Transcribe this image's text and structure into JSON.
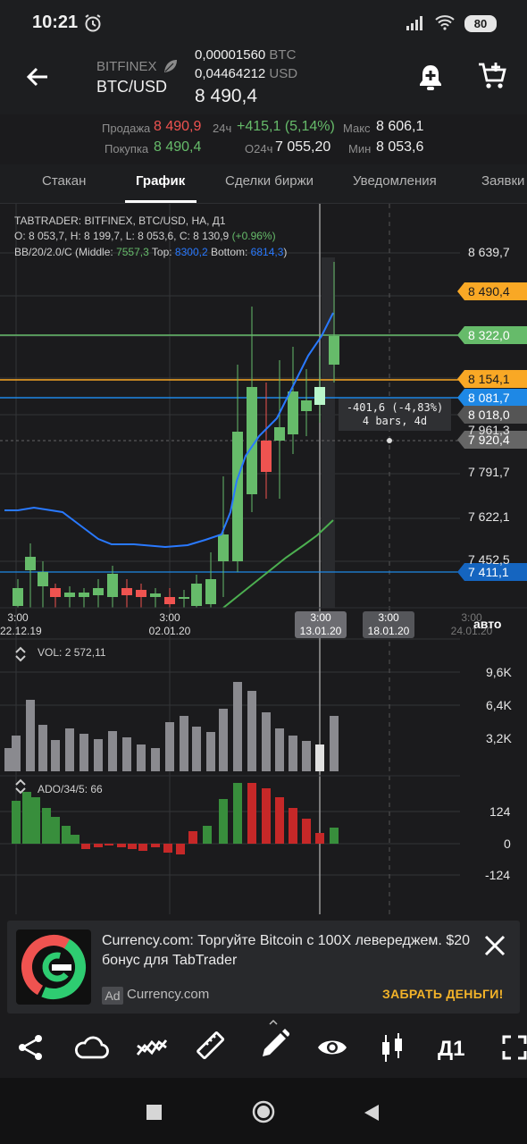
{
  "status_bar": {
    "time": "10:21",
    "battery": "80"
  },
  "header": {
    "exchange": "BITFINEX",
    "pair": "BTC/USD",
    "btc_value": "0,00001560",
    "btc_unit": "BTC",
    "usd_value": "0,04464212",
    "usd_unit": "USD",
    "price": "8 490,4"
  },
  "stats": {
    "sell_label": "Продажа",
    "sell_value": "8 490,9",
    "buy_label": "Покупка",
    "buy_value": "8 490,4",
    "change_label": "24ч",
    "change_value": "+415,1 (5,14%)",
    "volume_label": "О24ч",
    "volume_value": "7 055,20",
    "max_label": "Макс",
    "max_value": "8 606,1",
    "min_label": "Мин",
    "min_value": "8 053,6"
  },
  "tabs": [
    {
      "label": "Стакан"
    },
    {
      "label": "График"
    },
    {
      "label": "Сделки биржи"
    },
    {
      "label": "Уведомления"
    },
    {
      "label": "Заявки"
    }
  ],
  "chart_header": {
    "line1": "TABTRADER: BITFINEX, BTC/USD, НА, Д1",
    "o": "O: 8 053,7,",
    "h": "H: 8 199,7,",
    "l": "L: 8 053,6,",
    "c": "C: 8 130,9",
    "change": "(+0.96%)",
    "bb_prefix": "BB/20/2.0/C (Middle:",
    "bb_middle": "7557,3",
    "bb_top_label": "Top:",
    "bb_top": "8300,2",
    "bb_bottom_label": "Bottom:",
    "bb_bottom": "6814,3",
    "bb_close": ")"
  },
  "colors": {
    "up": "#66bb6a",
    "down": "#ef5350",
    "accent_blue": "#1e88e5",
    "bb_line": "#2979ff",
    "ma_line": "#4caf50",
    "orange": "#f9a825"
  },
  "chart_data": {
    "type": "candlestick",
    "price_axis_labels": [
      "8 639,7",
      "7 791,7",
      "7 622,1",
      "7 452,5",
      "7 961,3",
      "8 018,0"
    ],
    "price_tags": [
      {
        "value": "8 490,4",
        "color": "#f9a825"
      },
      {
        "value": "8 322,0",
        "color": "#66bb6a"
      },
      {
        "value": "8 154,1",
        "color": "#f9a825"
      },
      {
        "value": "8 081,7",
        "color": "#1e88e5"
      },
      {
        "value": "8 018,0",
        "color": "#555"
      },
      {
        "value": "7 920,4",
        "color": "#666"
      },
      {
        "value": "7 411,1",
        "color": "#1565c0"
      }
    ],
    "measure_tooltip": {
      "line1": "-401,6 (-4,83%)",
      "line2": "4 bars, 4d"
    },
    "time_labels": [
      {
        "time": "3:00",
        "date": "22.12.19"
      },
      {
        "time": "3:00",
        "date": "02.01.20"
      },
      {
        "time": "3:00",
        "date": "13.01.20"
      },
      {
        "time": "3:00",
        "date": "18.01.20"
      },
      {
        "time": "3:00",
        "date": "24.01.20"
      }
    ],
    "auto_label": "авто",
    "volume": {
      "label": "VOL:",
      "value": "2 572,11",
      "axis": [
        "9,6K",
        "6,4K",
        "3,2K"
      ]
    },
    "ado": {
      "label": "ADO/34/5:",
      "value": "66",
      "axis": [
        "124",
        "0",
        "-124"
      ]
    }
  },
  "ad": {
    "text": "Currency.com: Торгуйте Bitcoin с 100X левереджем. $20 бонус для TabTrader",
    "badge": "Ad",
    "source": "Currency.com",
    "cta": "ЗАБРАТЬ ДЕНЬГИ!"
  },
  "toolbar": {
    "timeframe": "Д1"
  }
}
